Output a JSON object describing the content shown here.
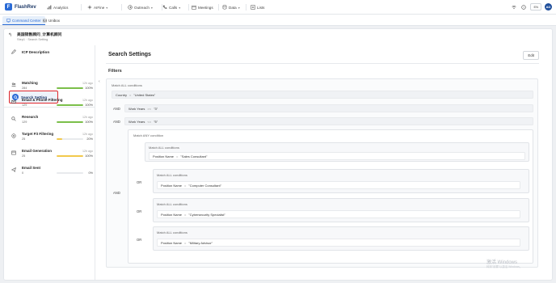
{
  "app": {
    "logo_letter": "F",
    "name": "FlashRev"
  },
  "nav": {
    "analytics": "Analytics",
    "allfine": "AIFine",
    "outreach": "Outreach",
    "calls": "Calls",
    "meetings": "Meetings",
    "data": "Data",
    "lists": "Lists",
    "lang": "EN",
    "avatar": "AD"
  },
  "tabs": {
    "command_center": "Command Center",
    "unibox": "Unibox"
  },
  "campaign": {
    "name": "美国销售顾问_计算机顾问",
    "crumb": "Step1 · Search Setting"
  },
  "left": {
    "icp": "ICP Description",
    "search_setting": "Search Setting",
    "steps": [
      {
        "name": "Matching",
        "ago": "12h ago",
        "count": "284",
        "pct": "100%",
        "pct_value": 100,
        "color": "#7bbf4a"
      },
      {
        "name": "Email & Phone Filtering",
        "ago": "12h ago",
        "count": "129",
        "pct": "100%",
        "pct_value": 100,
        "color": "#7bbf4a"
      },
      {
        "name": "Research",
        "ago": "12h ago",
        "count": "129",
        "pct": "100%",
        "pct_value": 100,
        "color": "#7bbf4a"
      },
      {
        "name": "Target Fit Filtering",
        "ago": "12h ago",
        "count": "25",
        "pct": "20%",
        "pct_value": 20,
        "color": "#f2c94c"
      },
      {
        "name": "Email Generation",
        "ago": "12h ago",
        "count": "25",
        "pct": "100%",
        "pct_value": 100,
        "color": "#f2c94c"
      },
      {
        "name": "Email Sent",
        "ago": "",
        "count": "0",
        "pct": "0%",
        "pct_value": 0,
        "color": "#cccccc"
      }
    ]
  },
  "main": {
    "title": "Search Settings",
    "edit": "Edit",
    "filters": "Filters",
    "match_all": "Match ALL conditions",
    "match_any": "Match ANY condition",
    "and": "AND",
    "or": "OR",
    "conditions": {
      "country": {
        "field": "Country",
        "op": "=",
        "value": "\"United States\""
      },
      "work1": {
        "field": "Work Years",
        "op": ">=",
        "value": "\"3\""
      },
      "work2": {
        "field": "Work Years",
        "op": "<=",
        "value": "\"5\""
      },
      "pos1": {
        "field": "Position Name",
        "op": "=",
        "value": "\"Sales Consultant\""
      },
      "pos2": {
        "field": "Position Name",
        "op": "=",
        "value": "\"Computer Consultant\""
      },
      "pos3": {
        "field": "Position Name",
        "op": "=",
        "value": "\"Cybersecurity Specialist\""
      },
      "pos4": {
        "field": "Position Name",
        "op": "=",
        "value": "\"Military Advisor\""
      }
    }
  },
  "os": {
    "watermark": "激活 Windows",
    "watermark_sub": "转到\"设置\"以激活 Windows。"
  }
}
